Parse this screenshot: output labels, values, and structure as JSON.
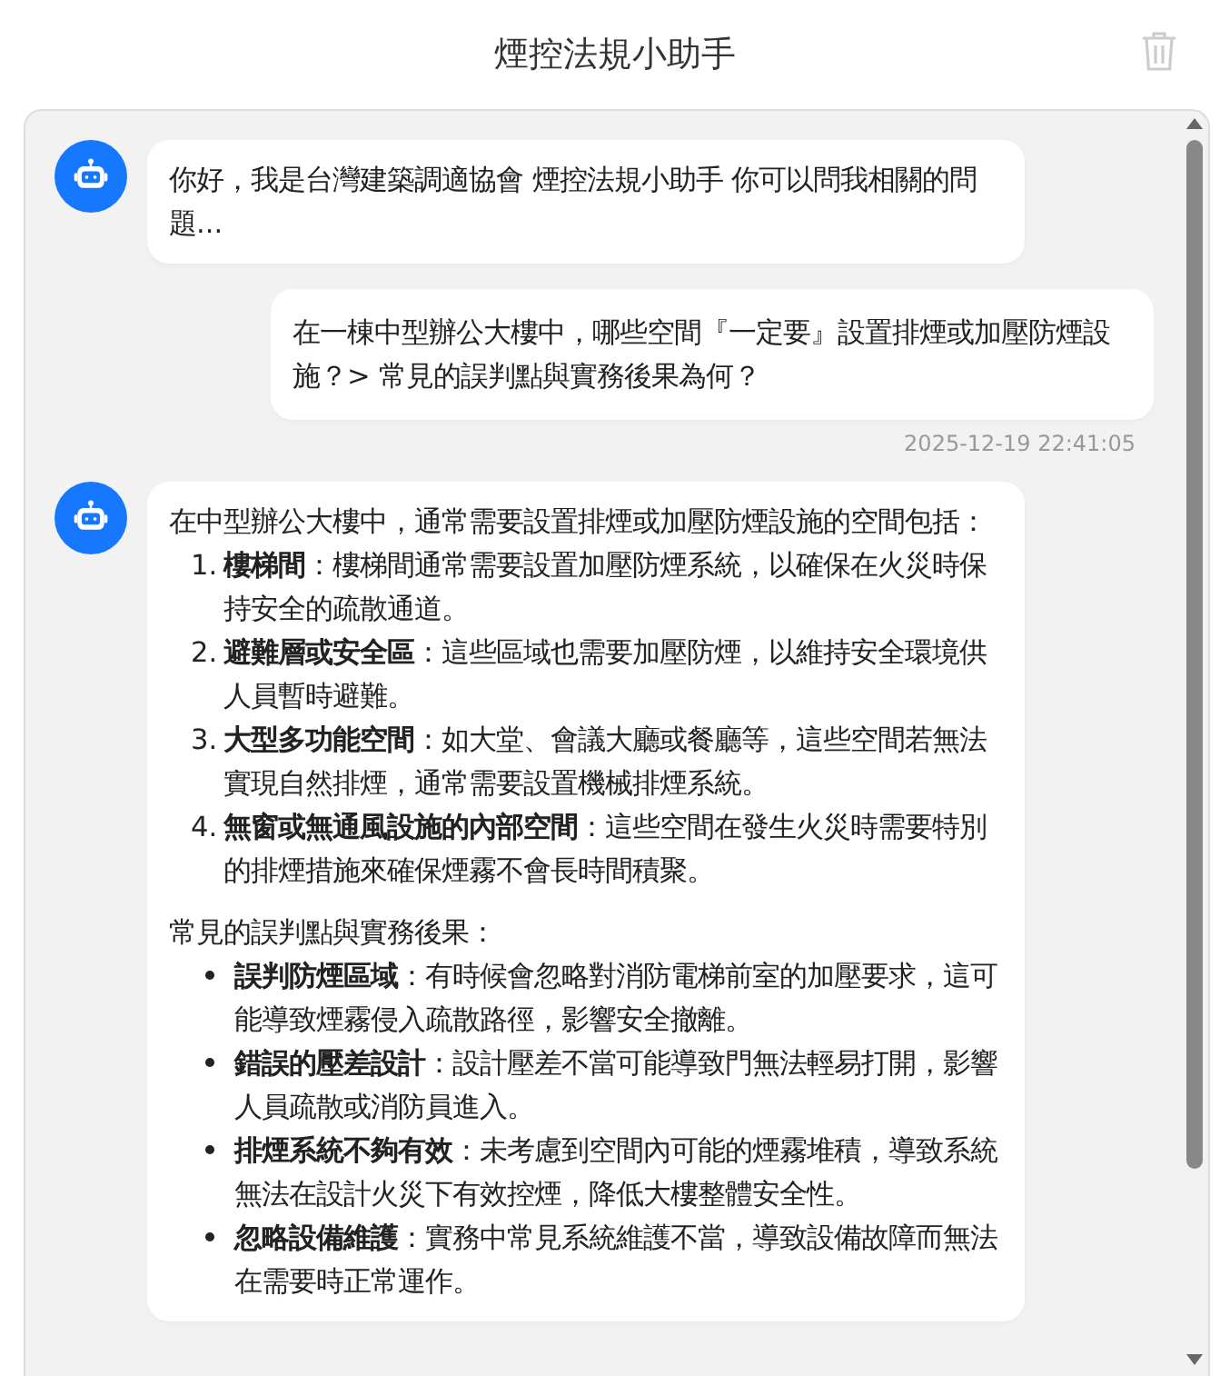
{
  "header": {
    "title": "煙控法規小助手"
  },
  "messages": [
    {
      "kind": "bot",
      "blocks": [
        {
          "kind": "paragraph",
          "text": "你好，我是台灣建築調適協會 煙控法規小助手 你可以問我相關的問題..."
        }
      ]
    },
    {
      "kind": "user",
      "text": "在一棟中型辦公大樓中，哪些空間『一定要』設置排煙或加壓防煙設施？> 常見的誤判點與實務後果為何？",
      "time": "2025-12-19 22:41:05"
    },
    {
      "kind": "bot",
      "blocks": [
        {
          "kind": "paragraph",
          "text": "在中型辦公大樓中，通常需要設置排煙或加壓防煙設施的空間包括："
        },
        {
          "kind": "ordered",
          "items": [
            {
              "marker": "1.",
              "text": "**樓梯間**：樓梯間通常需要設置加壓防煙系統，以確保在火災時保持安全的疏散通道。"
            },
            {
              "marker": "2.",
              "text": "**避難層或安全區**：這些區域也需要加壓防煙，以維持安全環境供人員暫時避難。"
            },
            {
              "marker": "3.",
              "text": "**大型多功能空間**：如大堂、會議大廳或餐廳等，這些空間若無法實現自然排煙，通常需要設置機械排煙系統。"
            },
            {
              "marker": "4.",
              "text": "**無窗或無通風設施的內部空間**：這些空間在發生火災時需要特別的排煙措施來確保煙霧不會長時間積聚。"
            }
          ]
        },
        {
          "kind": "paragraph",
          "text": "常見的誤判點與實務後果："
        },
        {
          "kind": "bullets",
          "items": [
            {
              "text": "**誤判防煙區域**：有時候會忽略對消防電梯前室的加壓要求，這可能導致煙霧侵入疏散路徑，影響安全撤離。"
            },
            {
              "text": "**錯誤的壓差設計**：設計壓差不當可能導致門無法輕易打開，影響人員疏散或消防員進入。"
            },
            {
              "text": "**排煙系統不夠有效**：未考慮到空間內可能的煙霧堆積，導致系統無法在設計火災下有效控煙，降低大樓整體安全性。"
            },
            {
              "text": "**忽略設備維護**：實務中常見系統維護不當，導致設備故障而無法在需要時正常運作。"
            }
          ]
        }
      ]
    }
  ]
}
